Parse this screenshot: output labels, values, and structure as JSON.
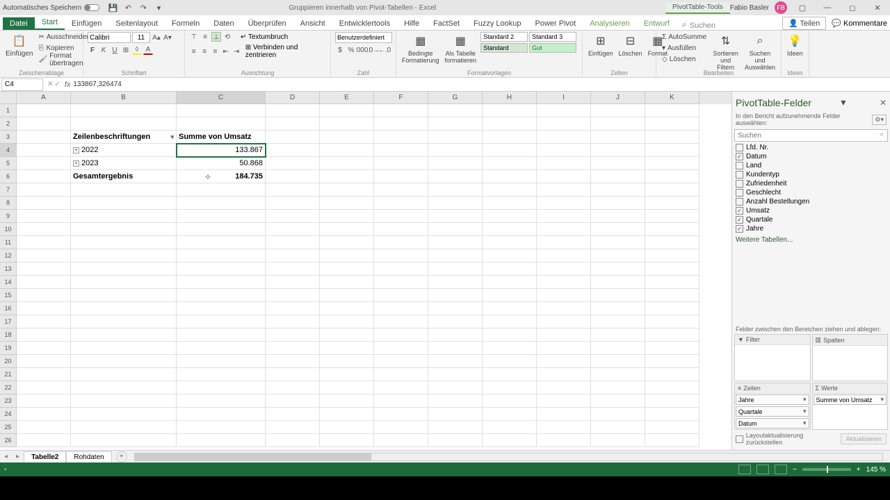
{
  "titlebar": {
    "autosave": "Automatisches Speichern",
    "doc_title": "Gruppieren innerhalb von Pivot-Tabellen - Excel",
    "tools": "PivotTable-Tools",
    "user": "Fabio Basler",
    "initials": "FB"
  },
  "tabs": {
    "file": "Datei",
    "items": [
      "Start",
      "Einfügen",
      "Seitenlayout",
      "Formeln",
      "Daten",
      "Überprüfen",
      "Ansicht",
      "Entwicklertools",
      "Hilfe",
      "FactSet",
      "Fuzzy Lookup",
      "Power Pivot"
    ],
    "context": [
      "Analysieren",
      "Entwurf"
    ],
    "search": "Suchen",
    "teilen": "Teilen",
    "kommentare": "Kommentare"
  },
  "ribbon": {
    "clipboard": {
      "paste": "Einfügen",
      "cut": "Ausschneiden",
      "copy": "Kopieren",
      "format_painter": "Format übertragen",
      "label": "Zwischenablage"
    },
    "font": {
      "name": "Calibri",
      "size": "11",
      "label": "Schriftart"
    },
    "align": {
      "wrap": "Textumbruch",
      "merge": "Verbinden und zentrieren",
      "label": "Ausrichtung"
    },
    "number": {
      "format": "Benutzerdefiniert",
      "label": "Zahl"
    },
    "styles": {
      "cond": "Bedingte\nFormatierung",
      "astable": "Als Tabelle\nformatieren",
      "s1": "Standard 2",
      "s2": "Standard 3",
      "s3": "Standard",
      "s4": "Gut",
      "label": "Formatvorlagen"
    },
    "cells": {
      "insert": "Einfügen",
      "delete": "Löschen",
      "format": "Format",
      "label": "Zellen"
    },
    "editing": {
      "autosum": "AutoSumme",
      "fill": "Ausfüllen",
      "clear": "Löschen",
      "sort": "Sortieren und\nFiltern",
      "find": "Suchen und\nAuswählen",
      "label": "Bearbeiten"
    },
    "ideas": {
      "label": "Ideen",
      "btn": "Ideen"
    }
  },
  "formula_bar": {
    "cell_ref": "C4",
    "value": "133867,326474"
  },
  "columns": [
    "A",
    "B",
    "C",
    "D",
    "E",
    "F",
    "G",
    "H",
    "I",
    "J",
    "K"
  ],
  "pivot": {
    "row_label": "Zeilenbeschriftungen",
    "val_label": "Summe von Umsatz",
    "rows": [
      {
        "label": "2022",
        "value": "133.867"
      },
      {
        "label": "2023",
        "value": "50.868"
      }
    ],
    "total_label": "Gesamtergebnis",
    "total_value": "184.735"
  },
  "sheets": {
    "active": "Tabelle2",
    "other": "Rohdaten"
  },
  "fieldpane": {
    "title": "PivotTable-Felder",
    "sub": "In den Bericht aufzunehmende Felder auswählen:",
    "search": "Suchen",
    "fields": [
      {
        "name": "Lfd. Nr.",
        "checked": false
      },
      {
        "name": "Datum",
        "checked": true
      },
      {
        "name": "Land",
        "checked": false
      },
      {
        "name": "Kundentyp",
        "checked": false
      },
      {
        "name": "Zufriedenheit",
        "checked": false
      },
      {
        "name": "Geschlecht",
        "checked": false
      },
      {
        "name": "Anzahl Bestellungen",
        "checked": false
      },
      {
        "name": "Umsatz",
        "checked": true
      },
      {
        "name": "Quartale",
        "checked": true
      },
      {
        "name": "Jahre",
        "checked": true
      }
    ],
    "more": "Weitere Tabellen...",
    "areas_label": "Felder zwischen den Bereichen ziehen und ablegen:",
    "filter": "Filter",
    "cols": "Spalten",
    "rowsarea": "Zeilen",
    "values": "Werte",
    "row_items": [
      "Jahre",
      "Quartale",
      "Datum"
    ],
    "val_items": [
      "Summe von Umsatz"
    ],
    "defer": "Layoutaktualisierung zurückstellen",
    "update": "Aktualisieren"
  },
  "statusbar": {
    "zoom": "145 %"
  }
}
